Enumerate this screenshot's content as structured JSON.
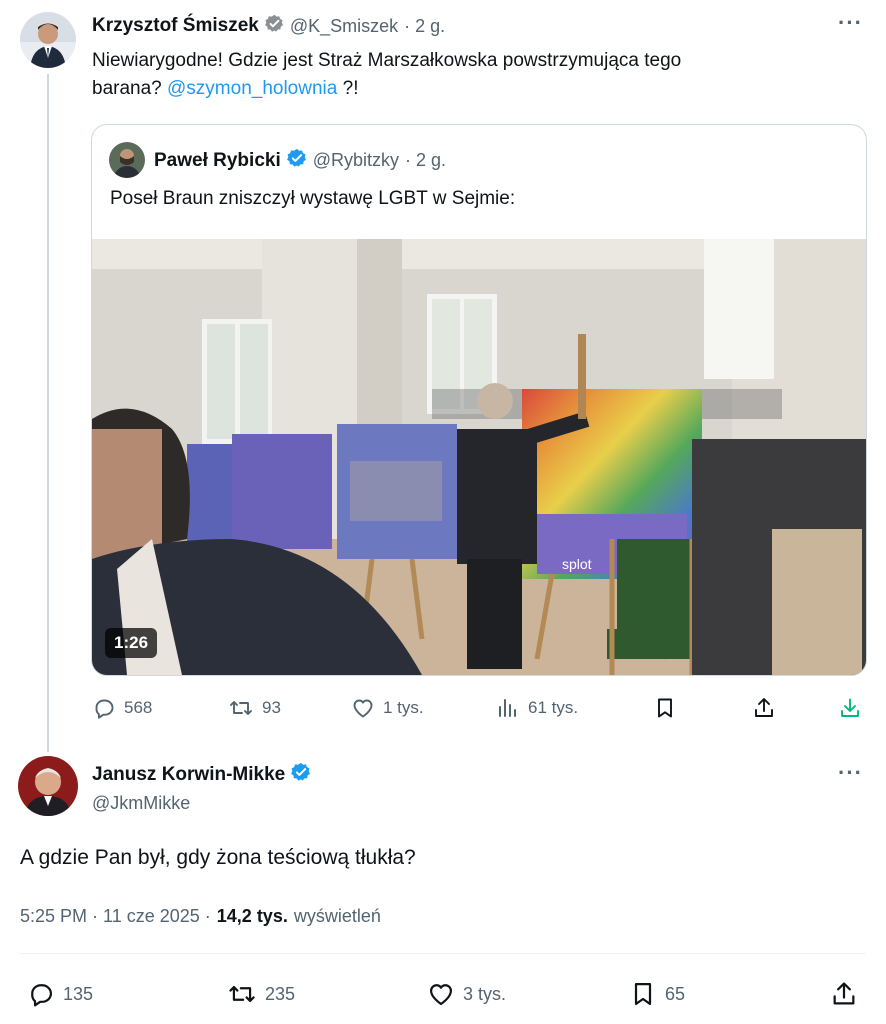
{
  "tweet": {
    "author_name": "Krzysztof Śmiszek",
    "author_handle": "@K_Smiszek",
    "time": "· 2 g.",
    "text_part1": "Niewiarygodne! Gdzie jest Straż Marszałkowska powstrzymująca tego",
    "text_part2": "barana?",
    "mention": "@szymon_holownia",
    "text_part3": "?!",
    "more_icon": "more-icon"
  },
  "quote": {
    "author_name": "Paweł Rybicki",
    "author_handle": "@Rybitzky",
    "time": "· 2 g.",
    "text": "Poseł Braun zniszczył wystawę LGBT w Sejmie:",
    "video_duration": "1:26",
    "banner_text": "splot"
  },
  "tweet_actions": {
    "replies": "568",
    "retweets": "93",
    "likes": "1 tys.",
    "views": "61 tys."
  },
  "reply": {
    "author_name": "Janusz Korwin-Mikke",
    "author_handle": "@JkmMikke",
    "text": "A gdzie Pan był, gdy żona teściową tłukła?",
    "timestamp": "5:25 PM · 11 cze 2025 ·",
    "views_count": "14,2 tys.",
    "views_label": "wyświetleń"
  },
  "reply_actions": {
    "replies": "135",
    "retweets": "235",
    "likes": "3 tys.",
    "bookmarks": "65"
  },
  "colors": {
    "verified": "#1d9bf0",
    "muted": "#536471",
    "download": "#00ba7c"
  }
}
